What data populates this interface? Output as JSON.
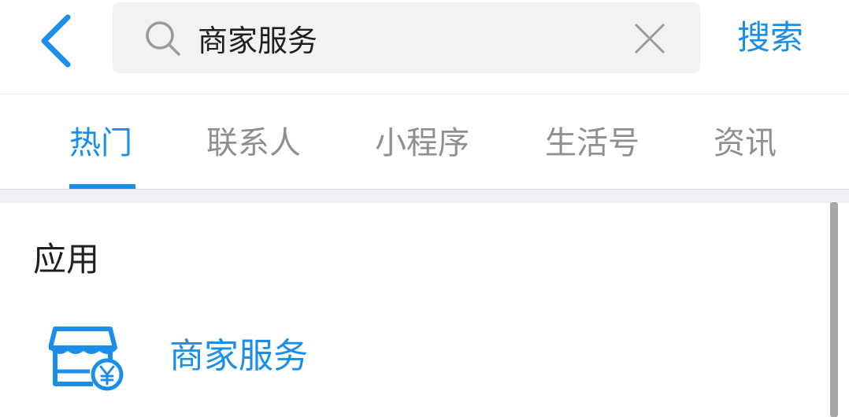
{
  "header": {
    "search_value": "商家服务",
    "search_button_label": "搜索"
  },
  "tabs": [
    {
      "label": "热门",
      "active": true
    },
    {
      "label": "联系人",
      "active": false
    },
    {
      "label": "小程序",
      "active": false
    },
    {
      "label": "生活号",
      "active": false
    },
    {
      "label": "资讯",
      "active": false
    }
  ],
  "section": {
    "title": "应用",
    "apps": [
      {
        "name": "商家服务",
        "icon": "shop-yen-icon"
      }
    ]
  },
  "icons": {
    "back": "chevron-left-icon",
    "search": "search-icon",
    "clear": "close-icon"
  },
  "colors": {
    "accent": "#1a8ee8",
    "tab_inactive": "#8f8f8f",
    "search_bg": "#f2f2f2",
    "band_bg": "#efeff4",
    "text_primary": "#1f1f1f"
  }
}
